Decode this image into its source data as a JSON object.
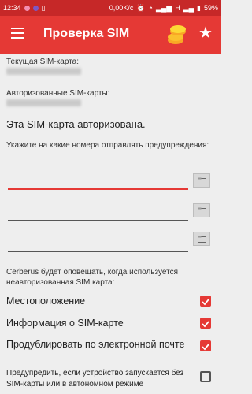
{
  "status_bar": {
    "time": "12:34",
    "speed": "0,00K/c",
    "network": "H",
    "battery": "59%"
  },
  "app_bar": {
    "title": "Проверка SIM",
    "menu_icon": "hamburger-menu-icon",
    "coins_icon": "coins-icon",
    "star_icon": "star-icon"
  },
  "sim": {
    "current_label": "Текущая SIM-карта:",
    "authorized_label": "Авторизованные SIM-карты:",
    "status": "Эта SIM-карта авторизована."
  },
  "alerts": {
    "prompt": "Укажите на какие номера отправлять предупреждения:",
    "numbers": [
      "",
      "",
      ""
    ]
  },
  "notify": {
    "description": "Cerberus будет оповещать, когда используется неавторизованная SIM карта:",
    "options": [
      {
        "label": "Местоположение",
        "checked": true
      },
      {
        "label": "Информация о SIM-карте",
        "checked": true
      },
      {
        "label": "Продублировать по электронной почте",
        "checked": true
      },
      {
        "label": "Предупредить, если устройство запускается без SIM-карты или в автономном режиме",
        "checked": false
      }
    ]
  },
  "colors": {
    "accent": "#e53935",
    "status_bar": "#c62828"
  }
}
